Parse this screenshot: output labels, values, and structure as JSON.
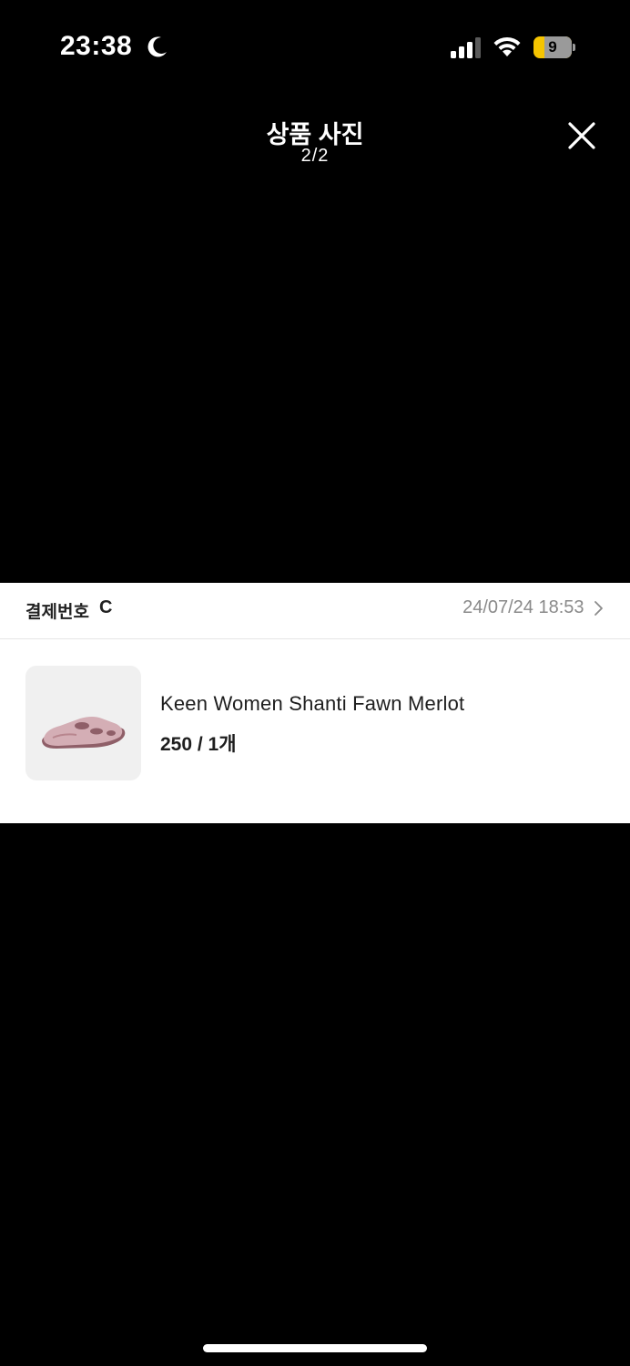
{
  "status_bar": {
    "time": "23:38",
    "battery_level": "9",
    "icons": [
      "moon-icon",
      "cellular-signal-icon",
      "wifi-icon",
      "battery-icon"
    ]
  },
  "header": {
    "title": "상품 사진",
    "counter": "2/2",
    "close_icon": "close-icon"
  },
  "order": {
    "payment_label": "결제번호",
    "payment_number": "C",
    "date": "24/07/24 18:53",
    "date_chevron_icon": "chevron-right-icon",
    "item": {
      "name": "Keen Women Shanti Fawn Merlot",
      "option": "250 / 1개",
      "image_icon": "product-thumbnail"
    }
  },
  "colors": {
    "background": "#000000",
    "card_background": "#ffffff",
    "date_text": "#8a8a8a",
    "battery_accent": "#f5c400",
    "product_pink": "#c9a0a8"
  }
}
